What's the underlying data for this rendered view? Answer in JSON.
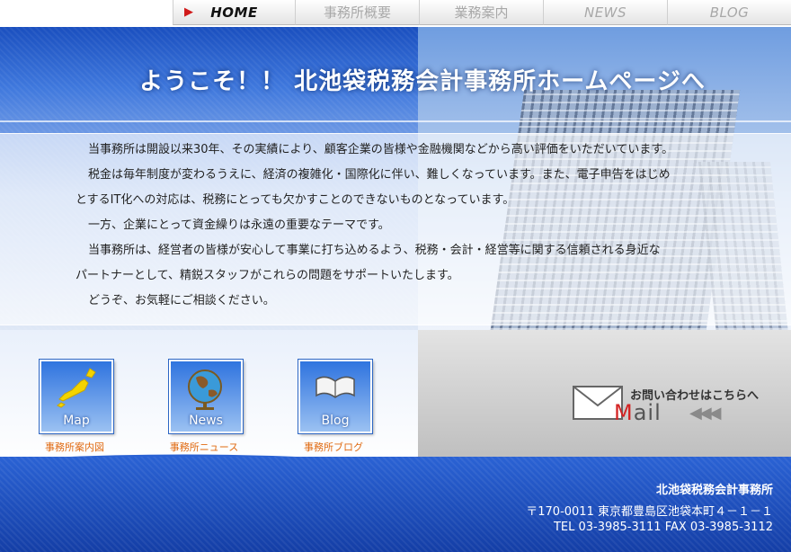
{
  "nav": {
    "items": [
      {
        "label": "HOME",
        "active": true
      },
      {
        "label": "事務所概要"
      },
      {
        "label": "業務案内"
      },
      {
        "label": "NEWS"
      },
      {
        "label": "BLOG"
      }
    ]
  },
  "hero": {
    "title": "ようこそ！！ 北池袋税務会計事務所ホームページへ",
    "paragraphs": [
      "当事務所は開設以来30年、その実績により、顧客企業の皆様や金融機関などから高い評価をいただいています。",
      "税金は毎年制度が変わるうえに、経済の複雑化・国際化に伴い、難しくなっています。また、電子申告をはじめ",
      "とするIT化への対応は、税務にとっても欠かすことのできないものとなっています。",
      "一方、企業にとって資金繰りは永遠の重要なテーマです。",
      "当事務所は、経営者の皆様が安心して事業に打ち込めるよう、税務・会計・経営等に関する信頼される身近な",
      "パートナーとして、精鋭スタッフがこれらの問題をサポートいたします。",
      "どうぞ、お気軽にご相談ください。"
    ]
  },
  "tiles": [
    {
      "label": "Map",
      "caption": "事務所案内図",
      "icon": "japan-map-icon"
    },
    {
      "label": "News",
      "caption": "事務所ニュース",
      "icon": "globe-icon"
    },
    {
      "label": "Blog",
      "caption": "事務所ブログ",
      "icon": "open-book-icon"
    }
  ],
  "mail": {
    "prompt": "お問い合わせはこちらへ",
    "word_first": "M",
    "word_rest": "ail",
    "arrows": "◀◀◀",
    "icon": "envelope-icon"
  },
  "footer": {
    "name": "北池袋税務会計事務所",
    "address": "〒170-0011  東京都豊島区池袋本町４－１－１",
    "phone": "TEL 03-3985-3111   FAX 03-3985-3112"
  },
  "colors": {
    "primary": "#1e55c8",
    "accent": "#d01a1a",
    "caption": "#e06a10"
  }
}
